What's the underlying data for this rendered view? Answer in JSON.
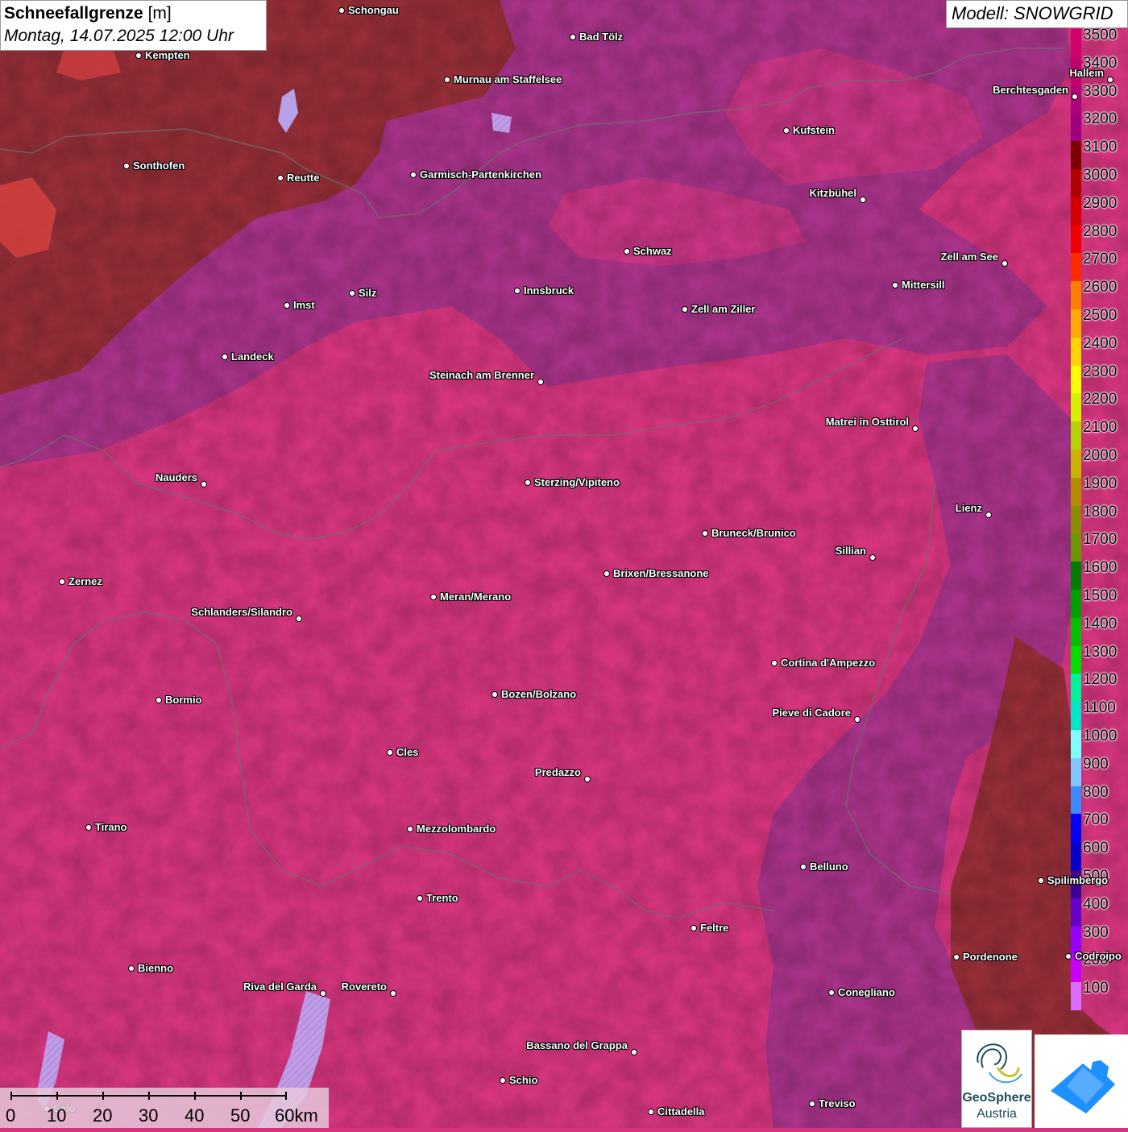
{
  "header": {
    "title_bold": "Schneefallgrenze",
    "title_unit": " [m]",
    "date": "Montag, 14.07.2025 12:00 Uhr",
    "model": "Modell: SNOWGRID"
  },
  "legend": {
    "labels": [
      "3500",
      "3400",
      "3300",
      "3200",
      "3100",
      "3000",
      "2900",
      "2800",
      "2700",
      "2600",
      "2500",
      "2400",
      "2300",
      "2200",
      "2100",
      "2000",
      "1900",
      "1800",
      "1700",
      "1600",
      "1500",
      "1400",
      "1300",
      "1200",
      "1100",
      "1000",
      "900",
      "800",
      "700",
      "600",
      "500",
      "400",
      "300",
      "200",
      "100"
    ],
    "colors": [
      "#d1006a",
      "#c1006e",
      "#b0007a",
      "#a00080",
      "#7d0000",
      "#b10000",
      "#d40000",
      "#ef0000",
      "#ff2a00",
      "#ff7e00",
      "#ffaa00",
      "#ffd400",
      "#ffff00",
      "#d4f000",
      "#b4d200",
      "#c8b400",
      "#b48c00",
      "#8c8c00",
      "#6e9600",
      "#007d00",
      "#00a000",
      "#00c000",
      "#00e000",
      "#00f29a",
      "#00e6c8",
      "#80ffff",
      "#80c8ff",
      "#3c8cff",
      "#0000ff",
      "#0000c8",
      "#3c0096",
      "#6400c8",
      "#9600ff",
      "#c800ff",
      "#dc6eff"
    ]
  },
  "cities": [
    {
      "name": "Schongau",
      "side": "r"
    },
    {
      "name": "Bad Tölz",
      "side": "r"
    },
    {
      "name": "Kempten",
      "side": "r"
    },
    {
      "name": "Murnau am Staffelsee",
      "side": "r"
    },
    {
      "name": "Hallein",
      "side": "l"
    },
    {
      "name": "Berchtesgaden",
      "side": "l"
    },
    {
      "name": "Kufstein",
      "side": "r"
    },
    {
      "name": "Sonthofen",
      "side": "r"
    },
    {
      "name": "Reutte",
      "side": "r"
    },
    {
      "name": "Garmisch-Partenkirchen",
      "side": "r"
    },
    {
      "name": "Kitzbühel",
      "side": "l"
    },
    {
      "name": "Schwaz",
      "side": "r"
    },
    {
      "name": "Zell am See",
      "side": "l"
    },
    {
      "name": "Mittersill",
      "side": "r"
    },
    {
      "name": "Innsbruck",
      "side": "r"
    },
    {
      "name": "Silz",
      "side": "r"
    },
    {
      "name": "Imst",
      "side": "r"
    },
    {
      "name": "Zell am Ziller",
      "side": "r"
    },
    {
      "name": "Landeck",
      "side": "r"
    },
    {
      "name": "Steinach am Brenner",
      "side": "l"
    },
    {
      "name": "Matrei in Osttirol",
      "side": "l"
    },
    {
      "name": "Nauders",
      "side": "l"
    },
    {
      "name": "Sterzing/Vipiteno",
      "side": "r"
    },
    {
      "name": "Lienz",
      "side": "l"
    },
    {
      "name": "Bruneck/Brunico",
      "side": "r"
    },
    {
      "name": "Sillian",
      "side": "l"
    },
    {
      "name": "Brixen/Bressanone",
      "side": "r"
    },
    {
      "name": "Zernez",
      "side": "r"
    },
    {
      "name": "Meran/Merano",
      "side": "r"
    },
    {
      "name": "Schlanders/Silandro",
      "side": "l"
    },
    {
      "name": "Cortina d'Ampezzo",
      "side": "r"
    },
    {
      "name": "Bozen/Bolzano",
      "side": "r"
    },
    {
      "name": "Bormio",
      "side": "r"
    },
    {
      "name": "Pieve di Cadore",
      "side": "l"
    },
    {
      "name": "Cles",
      "side": "r"
    },
    {
      "name": "Predazzo",
      "side": "l"
    },
    {
      "name": "Tirano",
      "side": "r"
    },
    {
      "name": "Mezzolombardo",
      "side": "r"
    },
    {
      "name": "Belluno",
      "side": "r"
    },
    {
      "name": "Spilimbergo",
      "side": "r"
    },
    {
      "name": "Trento",
      "side": "r"
    },
    {
      "name": "Feltre",
      "side": "r"
    },
    {
      "name": "Pordenone",
      "side": "r"
    },
    {
      "name": "Codroipo",
      "side": "r"
    },
    {
      "name": "Bienno",
      "side": "r"
    },
    {
      "name": "Riva del Garda",
      "side": "l"
    },
    {
      "name": "Rovereto",
      "side": "l"
    },
    {
      "name": "Conegliano",
      "side": "r"
    },
    {
      "name": "Bassano del Grappa",
      "side": "l"
    },
    {
      "name": "Schio",
      "side": "r"
    },
    {
      "name": "Salò",
      "side": "r"
    },
    {
      "name": "Treviso",
      "side": "r"
    },
    {
      "name": "Cittadella",
      "side": "r"
    }
  ],
  "scale": {
    "labels": [
      "0",
      "10",
      "20",
      "30",
      "40",
      "50",
      "60km"
    ]
  },
  "logos": {
    "geosphere_line1": "GeoSphere",
    "geosphere_line2": "Austria"
  }
}
